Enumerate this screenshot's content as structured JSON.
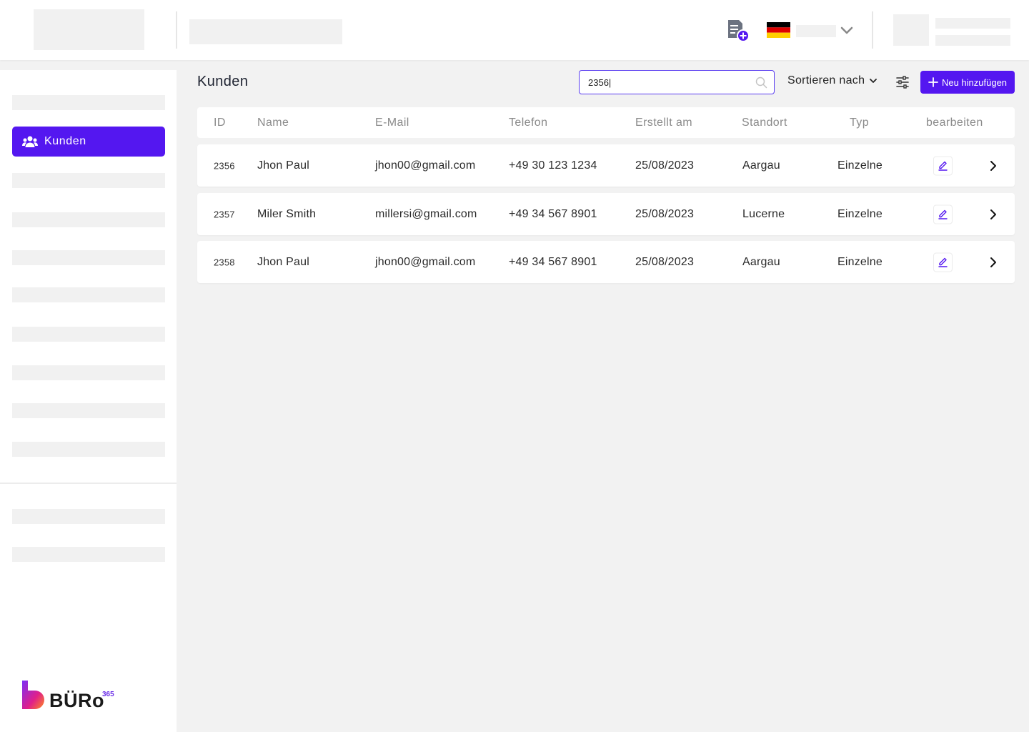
{
  "header": {
    "add_document_icon": "file-plus-icon",
    "language_flag": "germany-flag",
    "language_dropdown_icon": "chevron-down-icon"
  },
  "sidebar": {
    "active_item": {
      "label": "Kunden",
      "icon": "users-icon"
    },
    "logo": {
      "text": "BÜRo",
      "superscript": "365"
    }
  },
  "main": {
    "title": "Kunden",
    "search": {
      "value": "2356|",
      "placeholder": "",
      "icon": "search-icon"
    },
    "sort_label": "Sortieren nach",
    "filter_icon": "sliders-icon",
    "new_button_label": "Neu hinzufügen"
  },
  "table": {
    "columns": [
      "ID",
      "Name",
      "E-Mail",
      "Telefon",
      "Erstellt am",
      "Standort",
      "Typ",
      "bearbeiten"
    ],
    "rows": [
      {
        "id": "2356",
        "name": "Jhon Paul",
        "email": "jhon00@gmail.com",
        "phone": "+49 30 123 1234",
        "created": "25/08/2023",
        "location": "Aargau",
        "type": "Einzelne"
      },
      {
        "id": "2357",
        "name": "Miler Smith",
        "email": "millersi@gmail.com",
        "phone": "+49 34 567 8901",
        "created": "25/08/2023",
        "location": "Lucerne",
        "type": "Einzelne"
      },
      {
        "id": "2358",
        "name": "Jhon Paul",
        "email": "jhon00@gmail.com",
        "phone": "+49 34 567 8901",
        "created": "25/08/2023",
        "location": "Aargau",
        "type": "Einzelne"
      }
    ]
  },
  "colors": {
    "accent": "#5417f0",
    "background": "#f2f2f2",
    "placeholder": "#f1f1f1"
  }
}
